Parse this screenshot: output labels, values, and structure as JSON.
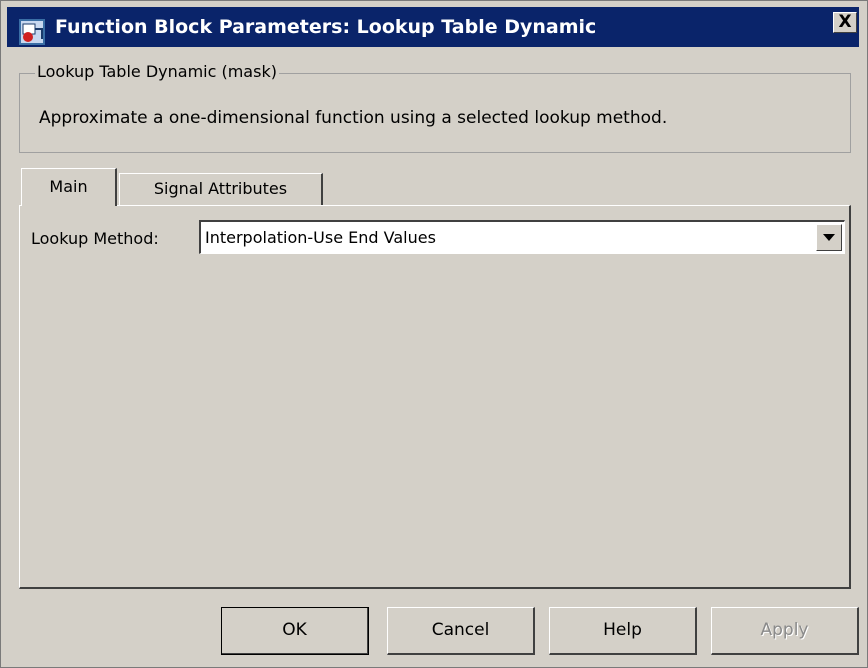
{
  "window": {
    "title": "Function Block Parameters: Lookup Table Dynamic",
    "close_label": "X",
    "icon": "simulink-block-icon"
  },
  "mask": {
    "legend": "Lookup Table Dynamic (mask)",
    "description": "Approximate a one-dimensional function using a selected lookup method."
  },
  "tabs": [
    {
      "label": "Main",
      "active": true
    },
    {
      "label": "Signal Attributes",
      "active": false
    }
  ],
  "main": {
    "lookup_method_label": "Lookup Method:",
    "lookup_method_value": "Interpolation-Use End Values"
  },
  "buttons": {
    "ok": "OK",
    "cancel": "Cancel",
    "help": "Help",
    "apply": "Apply",
    "apply_enabled": false
  },
  "colors": {
    "titlebar": "#0a246a",
    "face": "#d4d0c8"
  }
}
